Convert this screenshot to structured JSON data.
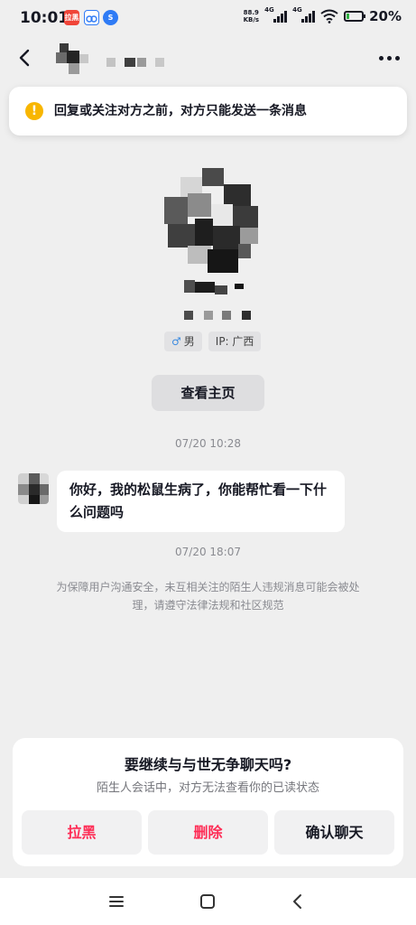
{
  "status_bar": {
    "time": "10:01",
    "app_badges": [
      {
        "icon": "red-app-icon",
        "label": "拉黑",
        "color": "#f04438"
      },
      {
        "icon": "cloud-app-icon",
        "label": "",
        "color": "#2f7bf5"
      },
      {
        "icon": "s-app-icon",
        "label": "S",
        "color": "#2f7bf5"
      }
    ],
    "net_speed_value": "88.9",
    "net_speed_unit": "KB/s",
    "signal_1_type": "4G",
    "signal_2_type": "4G",
    "battery_percent": "20%",
    "battery_level": 0.2
  },
  "header": {
    "back_icon": "chevron-left-icon",
    "more_icon": "more-dots-icon"
  },
  "notice": {
    "icon": "warning-icon",
    "text": "回复或关注对方之前，对方只能发送一条消息"
  },
  "profile": {
    "gender_icon": "male-icon",
    "gender_symbol": "♂",
    "gender_label": "男",
    "ip_label": "IP: 广西",
    "view_profile_button": "查看主页"
  },
  "chat": {
    "messages": [
      {
        "timestamp": "07/20 10:28",
        "text": "你好，我的松鼠生病了，你能帮忙看一下什么问题吗"
      }
    ],
    "timestamp_2": "07/20 18:07",
    "system_note": "为保障用户沟通安全，未互相关注的陌生人违规消息可能会被处理，请遵守法律法规和社区规范"
  },
  "prompt": {
    "title": "要继续与与世无争聊天吗?",
    "subtitle": "陌生人会话中，对方无法查看你的已读状态",
    "block_button": "拉黑",
    "delete_button": "删除",
    "confirm_button": "确认聊天",
    "accent_color": "#fe2c55"
  },
  "system_nav": {
    "menu_icon": "menu-icon",
    "home_icon": "home-square-icon",
    "back_icon": "triangle-back-icon"
  }
}
